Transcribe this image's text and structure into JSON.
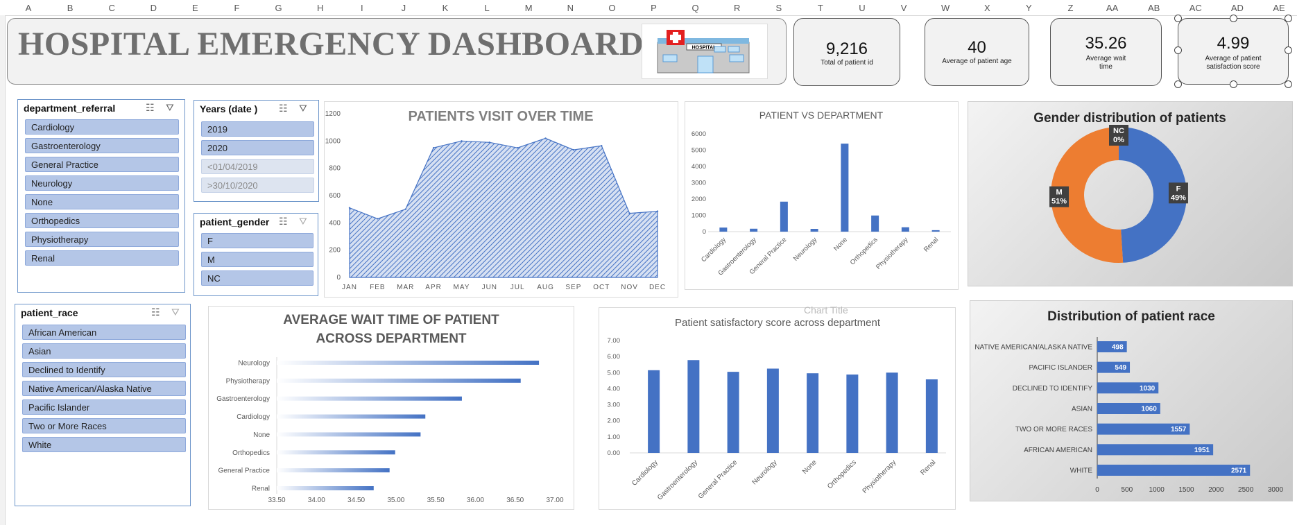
{
  "columns": [
    "A",
    "B",
    "C",
    "D",
    "E",
    "F",
    "G",
    "H",
    "I",
    "J",
    "K",
    "L",
    "M",
    "N",
    "O",
    "P",
    "Q",
    "R",
    "S",
    "T",
    "U",
    "V",
    "W",
    "X",
    "Y",
    "Z",
    "AA",
    "AB",
    "AC",
    "AD",
    "AE"
  ],
  "title": "HOSPITAL EMERGENCY DASHBOARD",
  "hospital_sign": "HOSPITAL",
  "kpis": [
    {
      "value": "9,216",
      "label": "Total of patient id"
    },
    {
      "value": "40",
      "label": "Average of patient age"
    },
    {
      "value": "35.26",
      "label": "Average wait time"
    },
    {
      "value": "4.99",
      "label": "Average of patient satisfaction score"
    }
  ],
  "slicers": {
    "department": {
      "title": "department_referral",
      "items": [
        "Cardiology",
        "Gastroenterology",
        "General Practice",
        "Neurology",
        "None",
        "Orthopedics",
        "Physiotherapy",
        "Renal"
      ]
    },
    "years": {
      "title": "Years (date )",
      "items": [
        "2019",
        "2020",
        "<01/04/2019",
        ">30/10/2020"
      ]
    },
    "gender": {
      "title": "patient_gender",
      "items": [
        "F",
        "M",
        "NC"
      ]
    },
    "race": {
      "title": "patient_race",
      "items": [
        "African American",
        "Asian",
        "Declined to Identify",
        "Native American/Alaska Native",
        "Pacific Islander",
        "Two or More Races",
        "White"
      ]
    }
  },
  "ghost_text": "Chart Title",
  "colors": {
    "accent": "#4472c4",
    "orange": "#ed7d31",
    "dark_label": "#404040",
    "title_gray": "#6f6f6f"
  },
  "chart_data": [
    {
      "id": "visits",
      "type": "area",
      "title": "PATIENTS VISIT OVER TIME",
      "categories": [
        "JAN",
        "FEB",
        "MAR",
        "APR",
        "MAY",
        "JUN",
        "JUL",
        "AUG",
        "SEP",
        "OCT",
        "NOV",
        "DEC"
      ],
      "values": [
        510,
        430,
        500,
        950,
        1000,
        990,
        950,
        1020,
        935,
        965,
        470,
        485
      ],
      "yticks": [
        "0",
        "200",
        "400",
        "600",
        "800",
        "1000",
        "1200"
      ],
      "ylim": [
        0,
        1200
      ]
    },
    {
      "id": "dept",
      "type": "bar",
      "title": "PATIENT VS DEPARTMENT",
      "categories": [
        "Cardiology",
        "Gastroenterology",
        "General Practice",
        "Neurology",
        "None",
        "Orthopedics",
        "Physiotherapy",
        "Renal"
      ],
      "values": [
        250,
        180,
        1840,
        170,
        5400,
        990,
        270,
        90
      ],
      "yticks": [
        "0",
        "1000",
        "2000",
        "3000",
        "4000",
        "5000",
        "6000"
      ],
      "ylim": [
        0,
        6000
      ]
    },
    {
      "id": "gender",
      "type": "pie",
      "title": "Gender distribution of patients",
      "slices": [
        {
          "label": "F",
          "pct": "49%",
          "value": 49
        },
        {
          "label": "M",
          "pct": "51%",
          "value": 51
        },
        {
          "label": "NC",
          "pct": "0%",
          "value": 0
        }
      ]
    },
    {
      "id": "wait",
      "type": "bar",
      "title": "AVERAGE WAIT TIME OF PATIENT ACROSS DEPARTMENT",
      "categories": [
        "Neurology",
        "Physiotherapy",
        "Gastroenterology",
        "Cardiology",
        "None",
        "Orthopedics",
        "General Practice",
        "Renal"
      ],
      "values": [
        36.8,
        36.57,
        35.83,
        35.37,
        35.31,
        34.99,
        34.92,
        34.72
      ],
      "xticks": [
        "33.50",
        "34.00",
        "34.50",
        "35.00",
        "35.50",
        "36.00",
        "36.50",
        "37.00"
      ],
      "xlim": [
        33.5,
        37.0
      ]
    },
    {
      "id": "satisfaction",
      "type": "bar",
      "title": "Patient satisfactory score across department",
      "categories": [
        "Cardiology",
        "Gastroenterology",
        "General Practice",
        "Neurology",
        "None",
        "Orthopedics",
        "Physiotherapy",
        "Renal"
      ],
      "values": [
        5.15,
        5.78,
        5.05,
        5.25,
        4.96,
        4.88,
        5.0,
        4.58
      ],
      "yticks": [
        "0.00",
        "1.00",
        "2.00",
        "3.00",
        "4.00",
        "5.00",
        "6.00",
        "7.00"
      ],
      "ylim": [
        0,
        7
      ]
    },
    {
      "id": "race",
      "type": "bar",
      "title": "Distribution of patient race",
      "categories": [
        "NATIVE AMERICAN/ALASKA NATIVE",
        "PACIFIC ISLANDER",
        "DECLINED TO IDENTIFY",
        "ASIAN",
        "TWO OR MORE RACES",
        "AFRICAN AMERICAN",
        "WHITE"
      ],
      "values": [
        498,
        549,
        1030,
        1060,
        1557,
        1951,
        2571
      ],
      "xticks": [
        "0",
        "500",
        "1000",
        "1500",
        "2000",
        "2500",
        "3000"
      ],
      "xlim": [
        0,
        3000
      ]
    }
  ]
}
